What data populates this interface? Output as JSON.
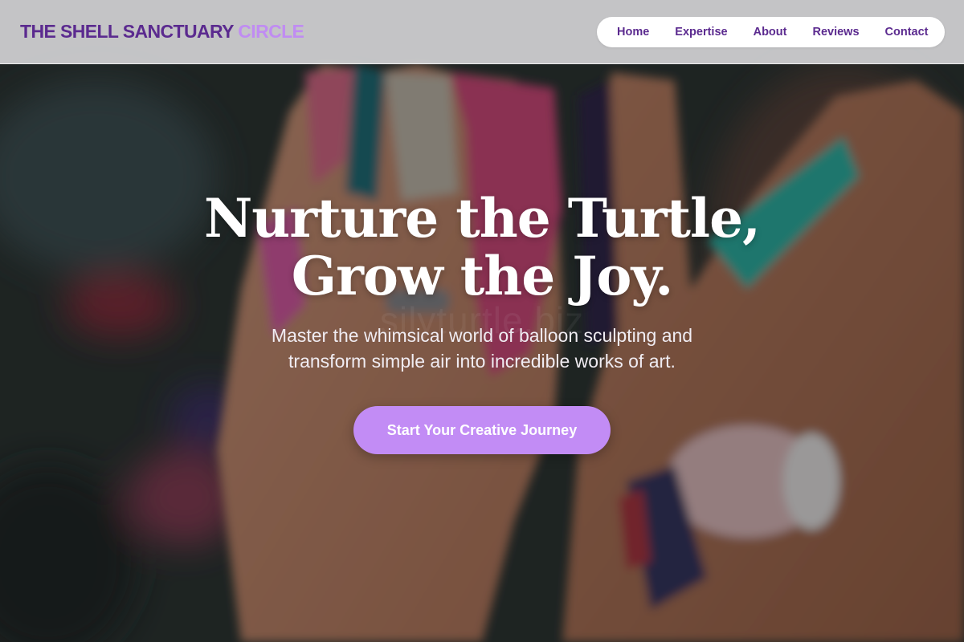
{
  "header": {
    "logo_main": "THE SHELL SANCTUARY",
    "logo_accent": "CIRCLE",
    "nav": [
      "Home",
      "Expertise",
      "About",
      "Reviews",
      "Contact"
    ]
  },
  "hero": {
    "title_line1": "Nurture the Turtle,",
    "title_line2": "Grow the Joy.",
    "subtitle": "Master the whimsical world of balloon sculpting and transform simple air into incredible works of art.",
    "cta_label": "Start Your Creative Journey",
    "watermark": "silyturtle.biz"
  },
  "colors": {
    "brand_purple": "#5b2a8f",
    "accent_lavender": "#c08cf2",
    "cta_background": "#c28cf5"
  }
}
